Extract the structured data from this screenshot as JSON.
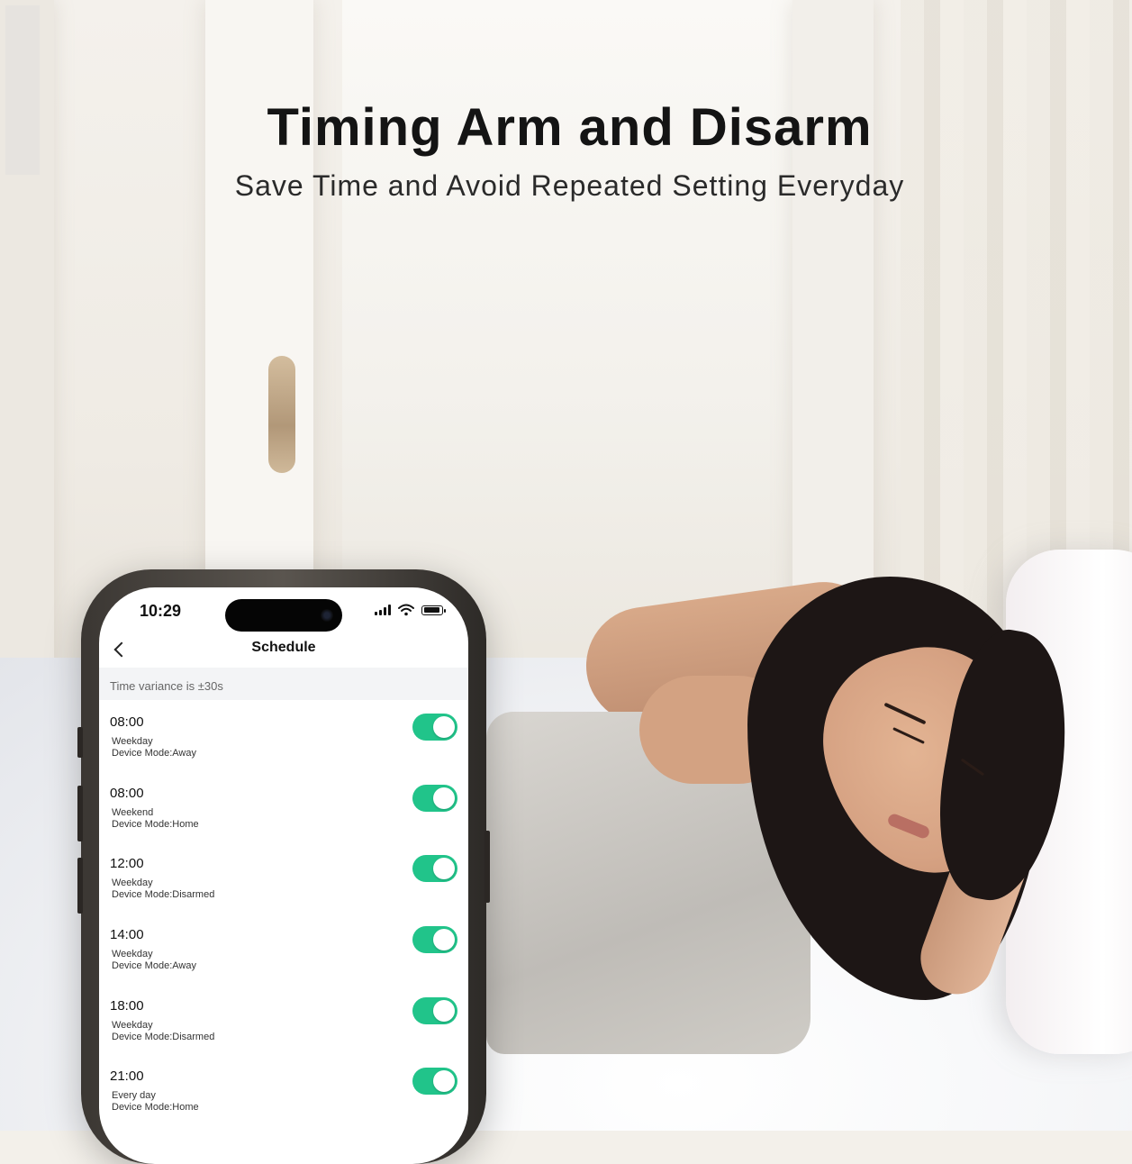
{
  "headline": {
    "title": "Timing Arm and Disarm",
    "subtitle": "Save Time and Avoid Repeated Setting Everyday"
  },
  "phone": {
    "status_bar": {
      "time": "10:29"
    },
    "nav": {
      "title": "Schedule"
    },
    "variance_text": "Time variance is  ±30s",
    "accent_color": "#21c48a",
    "schedules": [
      {
        "time": "08:00",
        "days": "Weekday",
        "mode": "Device Mode:Away",
        "enabled": true
      },
      {
        "time": "08:00",
        "days": "Weekend",
        "mode": "Device Mode:Home",
        "enabled": true
      },
      {
        "time": "12:00",
        "days": "Weekday",
        "mode": "Device Mode:Disarmed",
        "enabled": true
      },
      {
        "time": "14:00",
        "days": "Weekday",
        "mode": "Device Mode:Away",
        "enabled": true
      },
      {
        "time": "18:00",
        "days": "Weekday",
        "mode": "Device Mode:Disarmed",
        "enabled": true
      },
      {
        "time": "21:00",
        "days": "Every day",
        "mode": "Device Mode:Home",
        "enabled": true
      }
    ]
  }
}
